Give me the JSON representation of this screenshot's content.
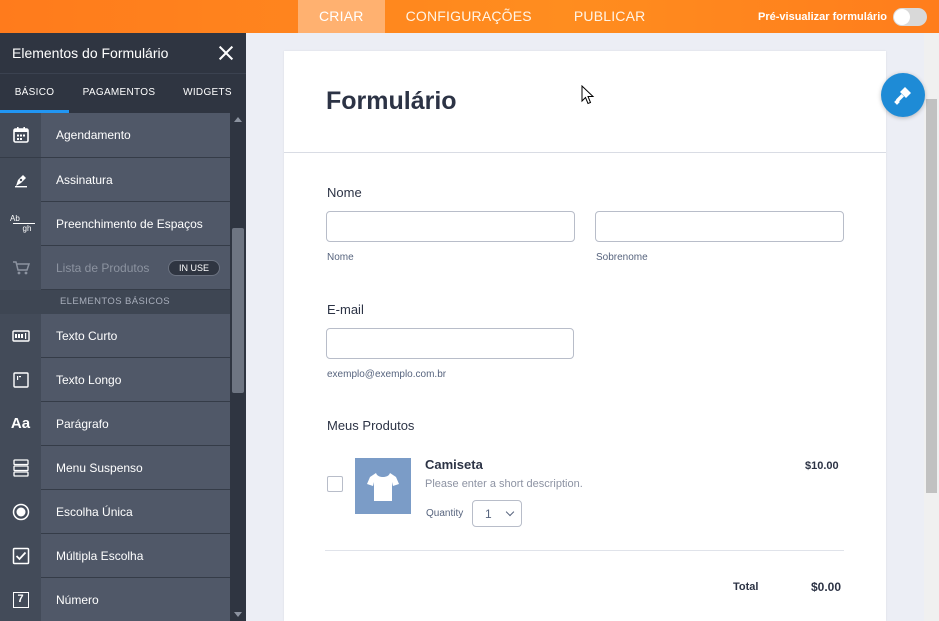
{
  "topbar": {
    "tabs": [
      {
        "label": "CRIAR",
        "active": true
      },
      {
        "label": "CONFIGURAÇÕES",
        "active": false
      },
      {
        "label": "PUBLICAR",
        "active": false
      }
    ],
    "preview_label": "Pré-visualizar formulário",
    "preview_on": false
  },
  "sidebar": {
    "title": "Elementos do Formulário",
    "tabs": [
      {
        "label": "BÁSICO",
        "active": true
      },
      {
        "label": "PAGAMENTOS",
        "active": false
      },
      {
        "label": "WIDGETS",
        "active": false
      }
    ],
    "items": [
      {
        "label": "Agendamento",
        "icon": "calendar-icon"
      },
      {
        "label": "Assinatura",
        "icon": "pen-icon"
      },
      {
        "label": "Preenchimento de Espaços",
        "icon": "fill-blank-icon",
        "icon_text_top": "Ab",
        "icon_text_bottom": "gh"
      },
      {
        "label": "Lista de Produtos",
        "icon": "cart-icon",
        "badge": "IN USE",
        "disabled": true
      }
    ],
    "section_header": "ELEMENTOS BÁSICOS",
    "basic_items": [
      {
        "label": "Texto Curto",
        "icon": "short-text-icon"
      },
      {
        "label": "Texto Longo",
        "icon": "long-text-icon"
      },
      {
        "label": "Parágrafo",
        "icon": "paragraph-icon",
        "icon_text": "Aa"
      },
      {
        "label": "Menu Suspenso",
        "icon": "dropdown-icon"
      },
      {
        "label": "Escolha Única",
        "icon": "radio-icon"
      },
      {
        "label": "Múltipla Escolha",
        "icon": "checkbox-icon"
      },
      {
        "label": "Número",
        "icon": "number-icon",
        "icon_text": "7"
      }
    ]
  },
  "form": {
    "title": "Formulário",
    "name_field": {
      "label": "Nome",
      "first_sublabel": "Nome",
      "last_sublabel": "Sobrenome",
      "first_value": "",
      "last_value": ""
    },
    "email_field": {
      "label": "E-mail",
      "value": "",
      "sublabel": "exemplo@exemplo.com.br"
    },
    "products": {
      "label": "Meus Produtos",
      "items": [
        {
          "name": "Camiseta",
          "description": "Please enter a short description.",
          "price": "$10.00",
          "quantity_label": "Quantity",
          "quantity": "1"
        }
      ],
      "total_label": "Total",
      "total_value": "$0.00"
    }
  },
  "colors": {
    "topbar": "#ff8a1f",
    "sidebar": "#3e4653",
    "accent": "#2196f3",
    "fab": "#1e8bd6",
    "product_image": "#7b9cc7"
  }
}
